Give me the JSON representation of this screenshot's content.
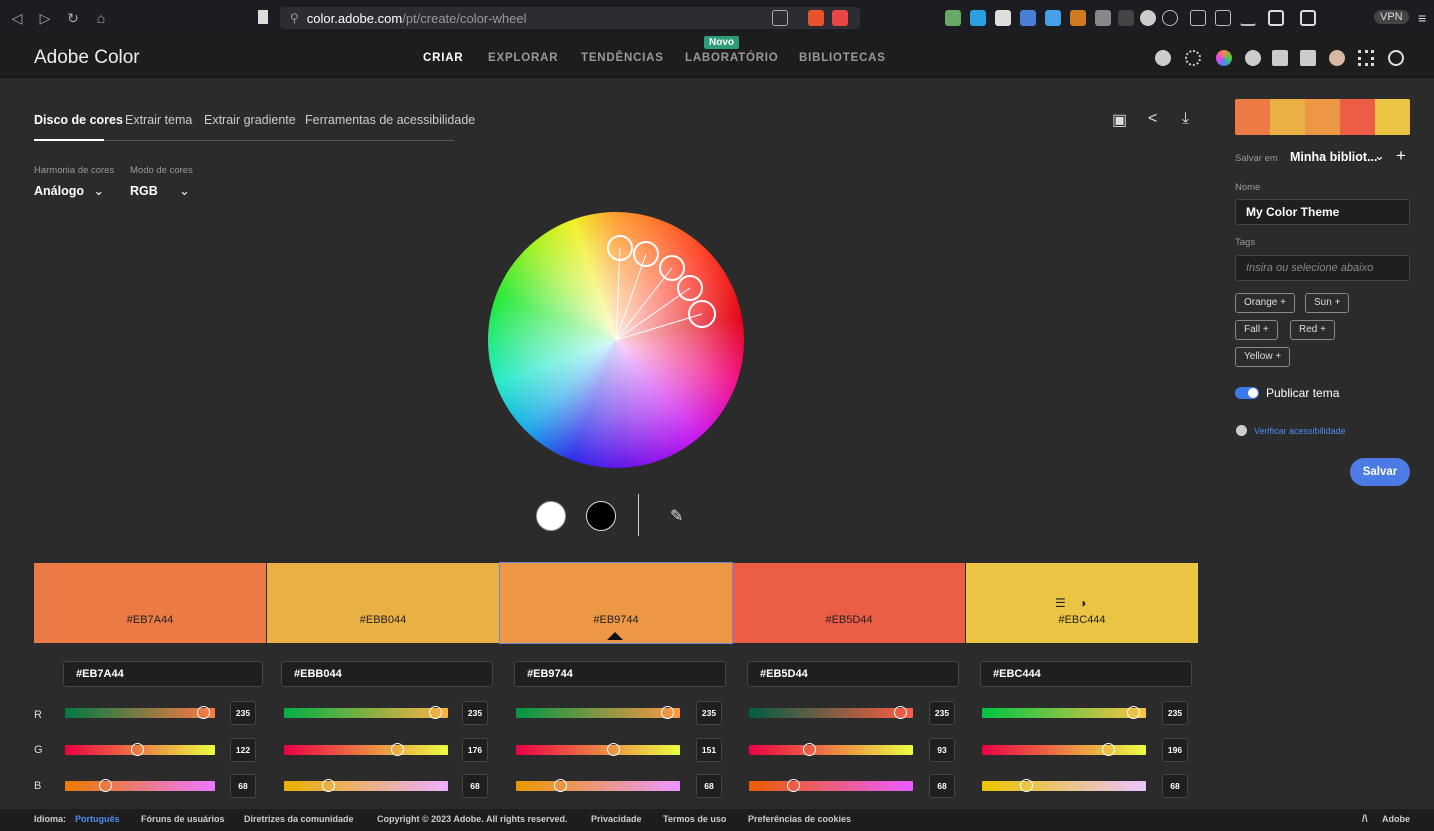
{
  "browser": {
    "url_host": "color.adobe.com",
    "url_path": "/pt/create/color-wheel",
    "vpn": "VPN"
  },
  "app": {
    "logo": "Adobe Color",
    "nav": [
      "CRIAR",
      "EXPLORAR",
      "TENDÊNCIAS",
      "LABORATÓRIO",
      "BIBLIOTECAS"
    ],
    "badge_novo": "Novo"
  },
  "tabs": [
    "Disco de cores",
    "Extrair tema",
    "Extrair gradiente",
    "Ferramentas de acessibilidade"
  ],
  "harmony": {
    "label": "Harmonia de cores",
    "value": "Análogo"
  },
  "color_mode": {
    "label": "Modo de cores",
    "value": "RGB"
  },
  "swatches": [
    {
      "hex": "#EB7A44",
      "r": 235,
      "g": 122,
      "b": 68
    },
    {
      "hex": "#EBB044",
      "r": 235,
      "g": 176,
      "b": 68
    },
    {
      "hex": "#EB9744",
      "r": 235,
      "g": 151,
      "b": 68
    },
    {
      "hex": "#EB5D44",
      "r": 235,
      "g": 93,
      "b": 68
    },
    {
      "hex": "#EBC444",
      "r": 235,
      "g": 196,
      "b": 68
    }
  ],
  "channels": [
    "R",
    "G",
    "B"
  ],
  "panel": {
    "save_in_label": "Salvar em",
    "library": "Minha bibliot...",
    "name_label": "Nome",
    "name_value": "My Color Theme",
    "tags_label": "Tags",
    "tags_placeholder": "Insira ou selecione abaixo",
    "tags": [
      "Orange +",
      "Sun +",
      "Fall +",
      "Red +",
      "Yellow +"
    ],
    "publish": "Publicar tema",
    "accessibility": "Verificar acessibilidade",
    "save": "Salvar"
  },
  "footer": {
    "language_label": "Idioma:",
    "language_value": "Português",
    "links": [
      "Fóruns de usuários",
      "Diretrizes da comunidade",
      "Copyright © 2023 Adobe. All rights reserved.",
      "Privacidade",
      "Termos de uso",
      "Preferências de cookies"
    ],
    "brand": "Adobe"
  }
}
